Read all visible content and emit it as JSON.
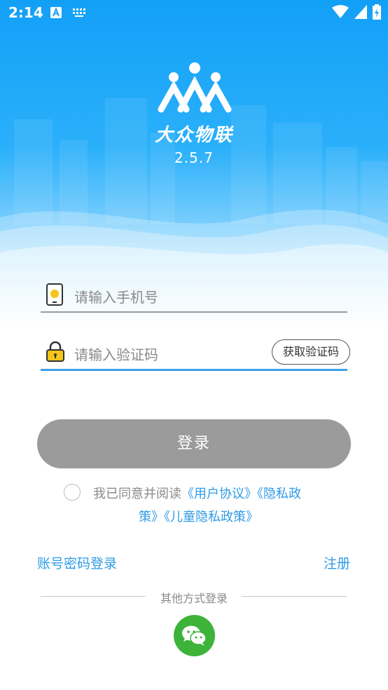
{
  "status_bar": {
    "time": "2:14"
  },
  "app": {
    "name": "大众物联",
    "version": "2.5.7"
  },
  "form": {
    "phone_placeholder": "请输入手机号",
    "code_placeholder": "请输入验证码",
    "get_code_label": "获取验证码",
    "login_label": "登录"
  },
  "agreement": {
    "prefix": "我已同意并阅读",
    "user_agreement": "《用户协议》",
    "privacy_part1": "《隐私政",
    "privacy_part2": "策》",
    "child_privacy": "《儿童隐私政策》"
  },
  "links": {
    "password_login": "账号密码登录",
    "register": "注册"
  },
  "other_login": {
    "label": "其他方式登录",
    "icon": "wechat-icon"
  },
  "colors": {
    "accent": "#2f9be6",
    "button_disabled": "#9b9b9b",
    "wechat": "#3db33a"
  }
}
